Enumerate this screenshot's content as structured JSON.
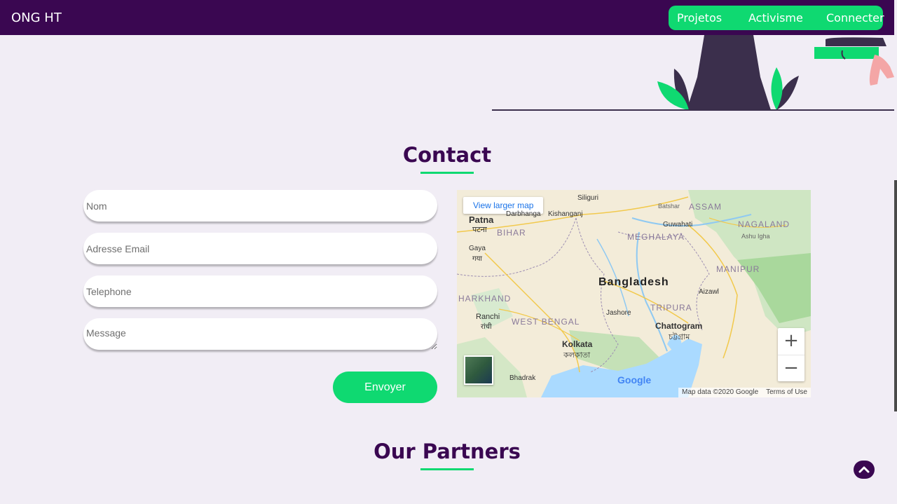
{
  "navbar": {
    "brand": "ONG HT",
    "links": [
      "Projetos",
      "Activisme",
      "Connecter"
    ]
  },
  "contact": {
    "title": "Contact",
    "fields": {
      "name_placeholder": "Nom",
      "email_placeholder": "Adresse Email",
      "phone_placeholder": "Telephone",
      "message_placeholder": "Message"
    },
    "submit_label": "Envoyer"
  },
  "map": {
    "view_larger": "View larger map",
    "labels": {
      "siliguri": "Siliguri",
      "darbhanga": "Darbhanga",
      "kishanganj": "Kishanganj",
      "patna": "Patna",
      "patna_local": "पटना",
      "bihar": "BIHAR",
      "gaya": "Gaya",
      "gaya_local": "गया",
      "jharkhand": "HARKHAND",
      "ranchi": "Ranchi",
      "ranchi_local": "रांची",
      "west_bengal": "WEST BENGAL",
      "kolkata": "Kolkata",
      "kolkata_local": "কলকাতা",
      "bhadrak": "Bhadrak",
      "assam": "ASSAM",
      "guwahati": "Guwahati",
      "batshar": "Batshar",
      "nagaland": "NAGALAND",
      "meghalaya": "MEGHALAYA",
      "manipur": "MANIPUR",
      "bangladesh": "Bangladesh",
      "aizawl": "Aizawl",
      "tripura": "TRIPURA",
      "jashore": "Jashore",
      "chattogram": "Chattogram",
      "chattogram_local": "চট্টগ্রাম",
      "ashu_igha": "Ashu Igha"
    },
    "zoom_in": "+",
    "zoom_out": "−",
    "google": "Google",
    "attribution": "Map data ©2020 Google",
    "terms": "Terms of Use"
  },
  "partners": {
    "title": "Our Partners"
  },
  "colors": {
    "primary": "#3a0751",
    "accent": "#0fd971",
    "background": "#f1edf5"
  },
  "icons": {
    "back_to_top": "chevron-up-icon"
  }
}
